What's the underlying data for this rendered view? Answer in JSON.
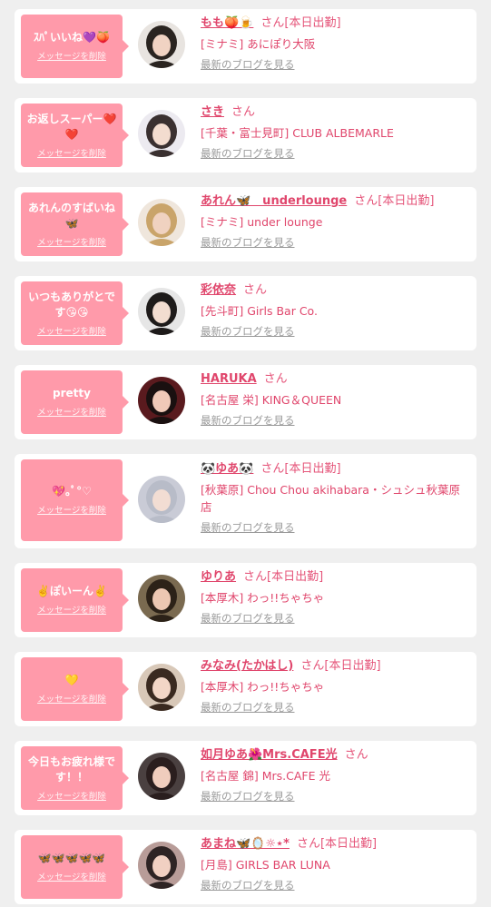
{
  "delete_label": "メッセージを削除",
  "blog_label": "最新のブログを見る",
  "working_label": "[本日出勤]",
  "colors": {
    "bubble": "#ff9aaa",
    "name": "#e0466c",
    "text": "#e5557a",
    "link_gray": "#9a9a9a"
  },
  "messages": [
    {
      "message": "ｽﾊﾟいいね💜🍑",
      "name": "もも🍑🍺",
      "suffix": "さん",
      "working": true,
      "shop": "[ミナミ] あにぽり大阪"
    },
    {
      "message": "お返しスーパー❤️❤️",
      "name": "さき",
      "suffix": "さん",
      "working": false,
      "shop": "[千葉・富士見町] CLUB ALBEMARLE"
    },
    {
      "message": "あれんのすばいね🦋",
      "name": "あれん🦋　underlounge",
      "suffix": "さん",
      "working": true,
      "shop": "[ミナミ] under lounge"
    },
    {
      "message": "いつもありがとです😘😘",
      "name": "彩依奈",
      "suffix": "さん",
      "working": false,
      "shop": "[先斗町] Girls Bar Co."
    },
    {
      "message": "pretty",
      "name": "HARUKA",
      "suffix": "さん",
      "working": false,
      "shop": "[名古屋 栄] KING＆QUEEN"
    },
    {
      "message": "💖｡ﾟ°♡",
      "name": "🐼ゆあ🐼",
      "suffix": "さん",
      "working": true,
      "shop": "[秋葉原] Chou Chou akihabara・シュシュ秋葉原店"
    },
    {
      "message": "✌️ぽいーん✌️",
      "name": "ゆりあ",
      "suffix": "さん",
      "working": true,
      "shop": "[本厚木] わっ!!ちゃちゃ"
    },
    {
      "message": "💛",
      "name": "みなみ(たかはし)",
      "suffix": "さん",
      "working": true,
      "shop": "[本厚木] わっ!!ちゃちゃ"
    },
    {
      "message": "今日もお疲れ様です！！",
      "name": "如月ゆあ🌺Mrs.CAFE光",
      "suffix": "さん",
      "working": false,
      "shop": "[名古屋 錦] Mrs.CAFE 光"
    },
    {
      "message": "🦋🦋🦋🦋🦋",
      "name": "あまね🦋🪞☼⋆*",
      "suffix": "さん",
      "working": true,
      "shop": "[月島] GIRLS BAR LUNA"
    }
  ]
}
